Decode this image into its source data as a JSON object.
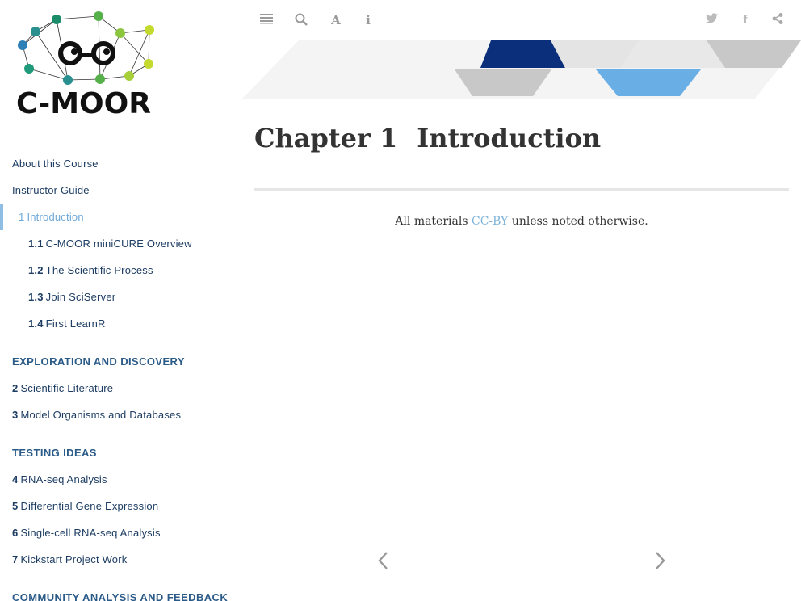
{
  "sidebar": {
    "logo_text": "C-MOOR",
    "items": [
      {
        "num": "",
        "label": "About this Course",
        "kind": "item"
      },
      {
        "num": "",
        "label": "Instructor Guide",
        "kind": "item"
      },
      {
        "num": "1",
        "label": "Introduction",
        "kind": "active"
      },
      {
        "num": "1.1",
        "label": "C-MOOR miniCURE Overview",
        "kind": "sub"
      },
      {
        "num": "1.2",
        "label": "The Scientific Process",
        "kind": "sub"
      },
      {
        "num": "1.3",
        "label": "Join SciServer",
        "kind": "sub"
      },
      {
        "num": "1.4",
        "label": "First LearnR",
        "kind": "sub"
      },
      {
        "num": "",
        "label": "Exploration and Discovery",
        "kind": "part"
      },
      {
        "num": "2",
        "label": "Scientific Literature",
        "kind": "item"
      },
      {
        "num": "3",
        "label": "Model Organisms and Databases",
        "kind": "item"
      },
      {
        "num": "",
        "label": "Testing Ideas",
        "kind": "part"
      },
      {
        "num": "4",
        "label": "RNA-seq Analysis",
        "kind": "item"
      },
      {
        "num": "5",
        "label": "Differential Gene Expression",
        "kind": "item"
      },
      {
        "num": "6",
        "label": "Single-cell RNA-seq Analysis",
        "kind": "item"
      },
      {
        "num": "7",
        "label": "Kickstart Project Work",
        "kind": "item"
      },
      {
        "num": "",
        "label": "Community Analysis and Feedback",
        "kind": "part"
      }
    ]
  },
  "toolbar": {
    "icons": [
      "toggle-sidebar-icon",
      "search-icon",
      "font-settings-icon",
      "info-icon",
      "twitter-icon",
      "facebook-icon",
      "share-icon"
    ]
  },
  "content": {
    "chapter_num": "Chapter 1",
    "chapter_title": "Introduction",
    "license_prefix": "All materials ",
    "license_link": "CC-BY",
    "license_suffix": " unless noted otherwise."
  },
  "colors": {
    "accent": "#7fb3d9",
    "banner_dark": "#0b2f7a",
    "banner_light": "#6aaee6",
    "banner_grey": "#c8c8c8"
  }
}
